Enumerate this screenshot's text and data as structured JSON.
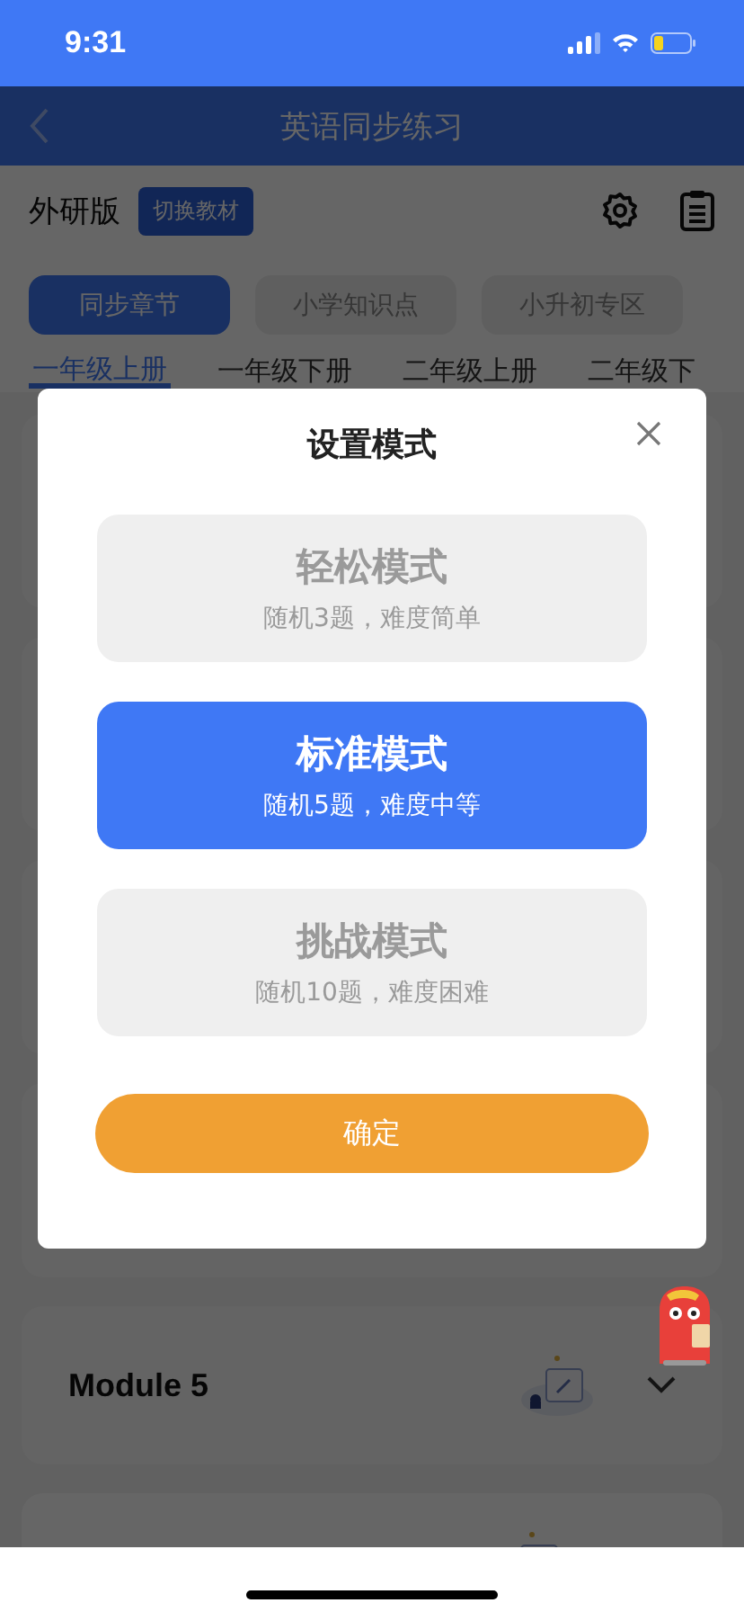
{
  "status_bar": {
    "time": "9:31"
  },
  "nav_bar": {
    "title": "英语同步练习"
  },
  "toolbar": {
    "edition": "外研版",
    "switch_button": "切换教材"
  },
  "categories": [
    {
      "label": "同步章节",
      "selected": true
    },
    {
      "label": "小学知识点",
      "selected": false
    },
    {
      "label": "小升初专区",
      "selected": false
    }
  ],
  "grades": [
    {
      "label": "一年级上册",
      "selected": true
    },
    {
      "label": "一年级下册",
      "selected": false
    },
    {
      "label": "二年级上册",
      "selected": false
    },
    {
      "label": "二年级下",
      "selected": false
    }
  ],
  "modules": [
    {
      "title": "Module 5"
    }
  ],
  "dialog": {
    "title": "设置模式",
    "modes": [
      {
        "name": "轻松模式",
        "description": "随机3题，难度简单",
        "selected": false
      },
      {
        "name": "标准模式",
        "description": "随机5题，难度中等",
        "selected": true
      },
      {
        "name": "挑战模式",
        "description": "随机10题，难度困难",
        "selected": false
      }
    ],
    "confirm": "确定"
  }
}
